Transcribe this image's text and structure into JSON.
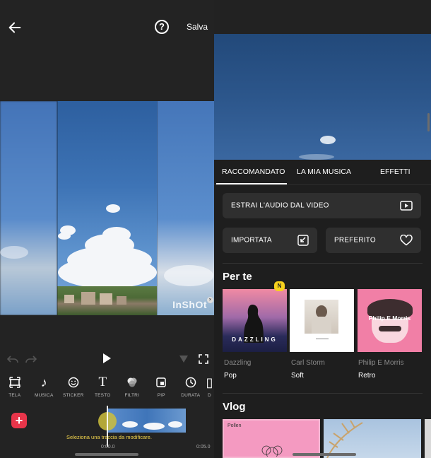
{
  "left": {
    "header": {
      "save_label": "Salva",
      "help_icon": "help-icon",
      "back_icon": "back-arrow-icon"
    },
    "preview": {
      "watermark": "InShOt"
    },
    "toolbar": [
      {
        "label": "TELA",
        "icon": "canvas-icon"
      },
      {
        "label": "MUSICA",
        "icon": "music-note-icon"
      },
      {
        "label": "STICKER",
        "icon": "smiley-icon"
      },
      {
        "label": "TESTO",
        "icon": "text-icon"
      },
      {
        "label": "FILTRI",
        "icon": "filter-icon"
      },
      {
        "label": "PIP",
        "icon": "pip-icon"
      },
      {
        "label": "DURATA",
        "icon": "clock-icon"
      },
      {
        "label": "D",
        "icon": "more-icon"
      }
    ],
    "timeline": {
      "hint": "Seleziona una traccia da modificare.",
      "time_current": "0:00.0",
      "time_end": "0:05.0"
    }
  },
  "right": {
    "tabs": [
      {
        "label": "RACCOMANDATO",
        "active": true
      },
      {
        "label": "LA MIA MUSICA",
        "active": false
      },
      {
        "label": "EFFETTI",
        "active": false
      }
    ],
    "extract_audio_label": "ESTRAI L'AUDIO DAL VIDEO",
    "imported_label": "IMPORTATA",
    "favorite_label": "PREFERITO",
    "section_for_you": "Per te",
    "section_vlog": "Vlog",
    "new_badge": "N",
    "albums": [
      {
        "name": "Dazzling",
        "genre": "Pop",
        "cover_text": "DAZZLING"
      },
      {
        "name": "Carl Storm",
        "genre": "Soft",
        "cover_text": ""
      },
      {
        "name": "Philip E Morris",
        "genre": "Retro",
        "cover_text": "Philip E Morris"
      }
    ],
    "vlog_cards": [
      {
        "cover_text": "Pollen"
      }
    ]
  },
  "colors": {
    "accent_red": "#e8354a",
    "badge_yellow": "#f7d11d",
    "hint_yellow": "#f2d44d"
  }
}
